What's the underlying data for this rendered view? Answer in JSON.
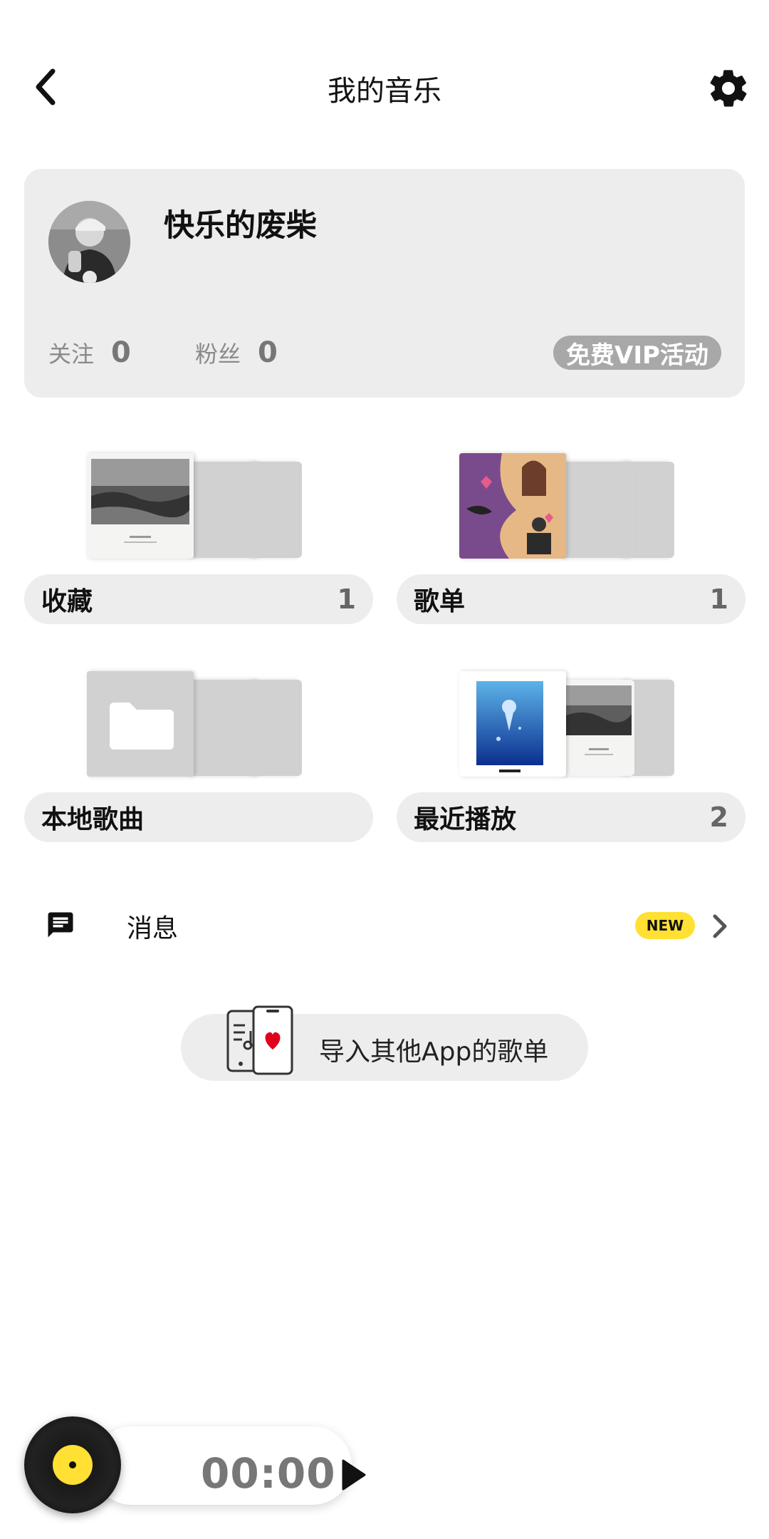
{
  "header": {
    "title": "我的音乐",
    "back_icon": "chevron-left-icon",
    "settings_icon": "gear-icon"
  },
  "profile": {
    "username": "快乐的废柴",
    "following_label": "关注",
    "following_count": "0",
    "followers_label": "粉丝",
    "followers_count": "0",
    "vip_label": "免费VIP活动"
  },
  "tiles": [
    {
      "label": "收藏",
      "count": "1"
    },
    {
      "label": "歌单",
      "count": "1"
    },
    {
      "label": "本地歌曲",
      "count": ""
    },
    {
      "label": "最近播放",
      "count": "2"
    }
  ],
  "message": {
    "label": "消息",
    "badge": "NEW"
  },
  "import": {
    "label": "导入其他App的歌单"
  },
  "player": {
    "time": "00:00"
  },
  "colors": {
    "accent": "#ffe033",
    "card_bg": "#ededed",
    "heart": "#e0001b"
  }
}
